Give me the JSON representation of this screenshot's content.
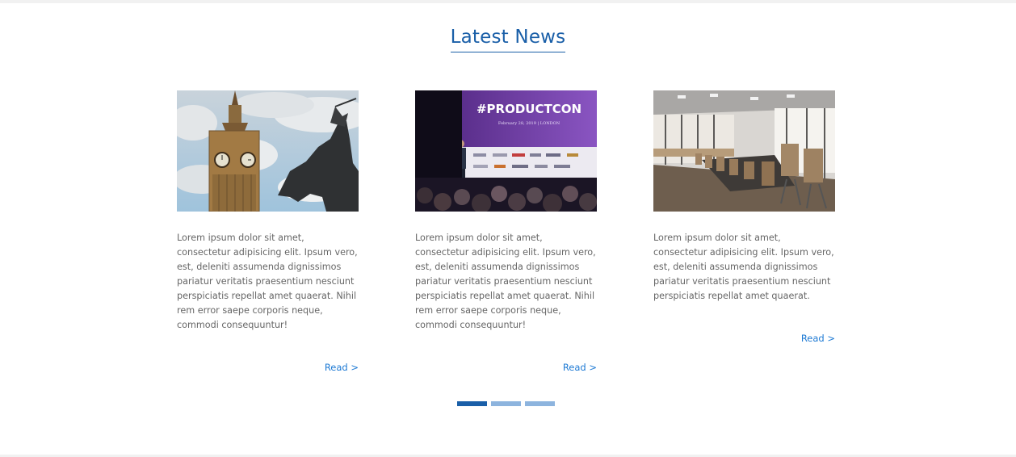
{
  "section": {
    "title": "Latest News"
  },
  "articles": [
    {
      "image": "big-ben-photo",
      "excerpt": "Lorem ipsum dolor sit amet, consectetur adipisicing elit. Ipsum vero, est, deleniti assumenda dignissimos pariatur veritatis praesentium nesciunt perspiciatis repellat amet quaerat. Nihil rem error saepe corporis neque, commodi consequuntur!",
      "read_label": "Read >"
    },
    {
      "image": "conference-stage-photo",
      "image_text": {
        "headline": "#PRODUCTCON",
        "subline": "February 28, 2019 | LONDON"
      },
      "excerpt": "Lorem ipsum dolor sit amet, consectetur adipisicing elit. Ipsum vero, est, deleniti assumenda dignissimos pariatur veritatis praesentium nesciunt perspiciatis repellat amet quaerat. Nihil rem error saepe corporis neque, commodi consequuntur!",
      "read_label": "Read >"
    },
    {
      "image": "boardroom-photo",
      "excerpt": "Lorem ipsum dolor sit amet, consectetur adipisicing elit. Ipsum vero, est, deleniti assumenda dignissimos pariatur veritatis praesentium nesciunt perspiciatis repellat amet quaerat.",
      "read_label": "Read >"
    }
  ],
  "pagination": {
    "pages": 3,
    "active": 1
  },
  "colors": {
    "accent": "#1a5fa8",
    "link": "#1e7ad4",
    "inactive_dot": "#8db4de",
    "text": "#666666"
  }
}
